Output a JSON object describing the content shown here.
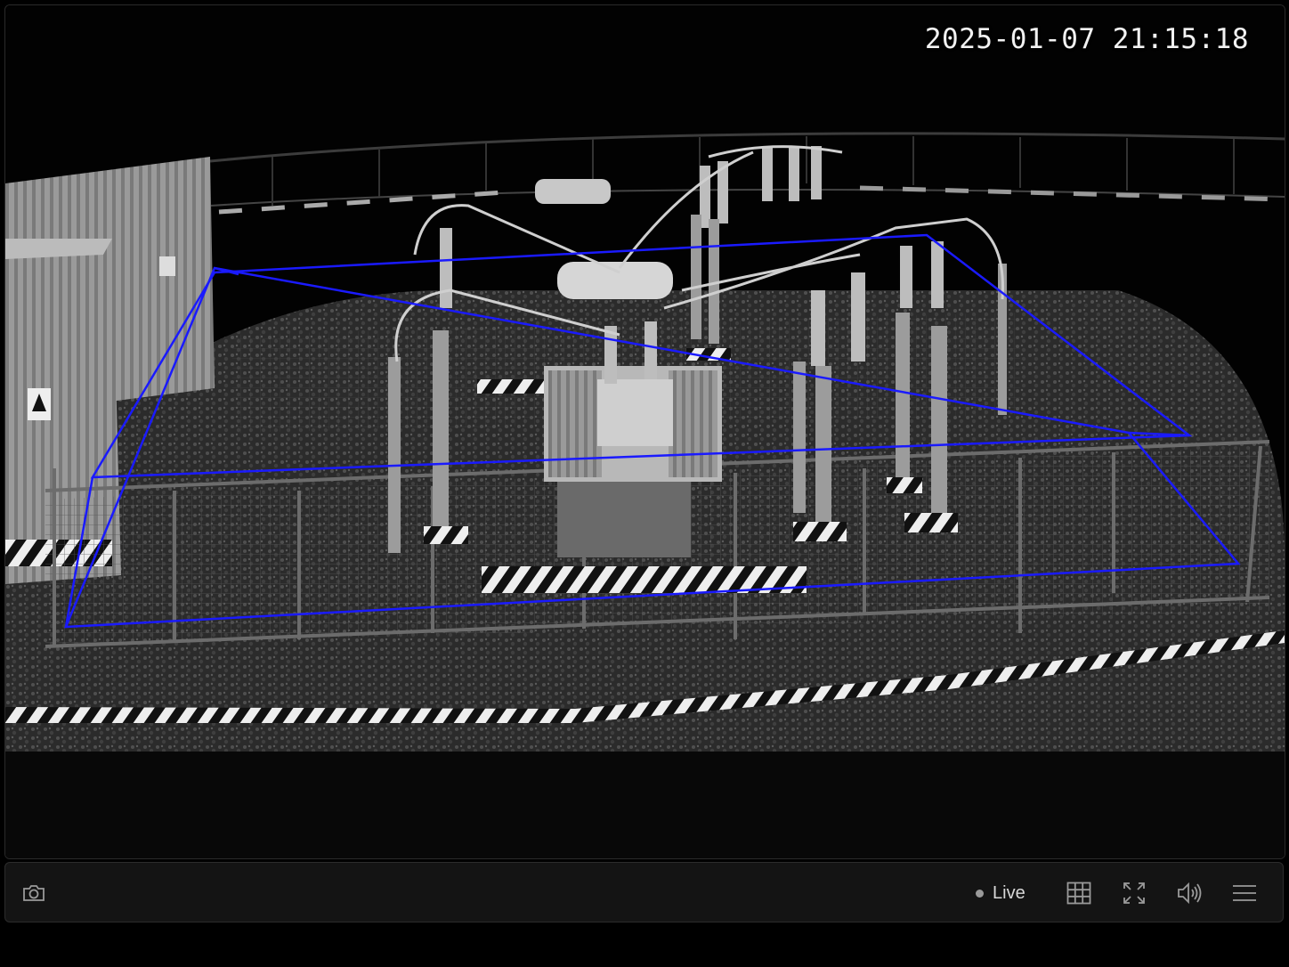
{
  "camera": {
    "timestamp": "2025-01-07 21:15:18"
  },
  "overlay": {
    "zone_color": "#1a1aff"
  },
  "toolbar": {
    "snapshot_icon": "camera-icon",
    "live_label": "Live",
    "grid_icon": "grid-icon",
    "fullscreen_icon": "fullscreen-icon",
    "volume_icon": "volume-icon",
    "menu_icon": "menu-icon"
  }
}
